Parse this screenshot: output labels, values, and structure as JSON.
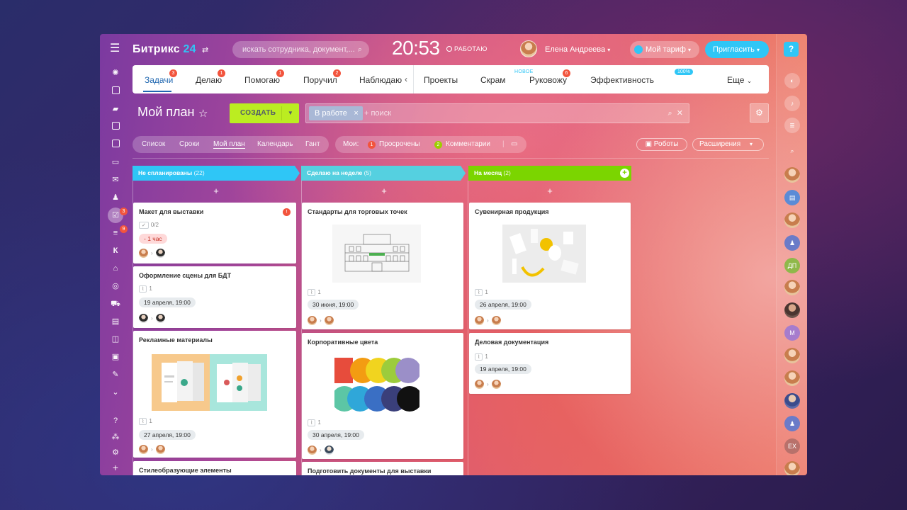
{
  "header": {
    "logo_name": "Битрикс",
    "logo_num": "24",
    "search_placeholder": "искать сотрудника, документ,...",
    "clock": "20:53",
    "work_status": "РАБОТАЮ",
    "user_name": "Елена Андреева",
    "tariff_label": "Мой тариф",
    "invite_label": "Пригласить",
    "help_label": "?"
  },
  "tabs": [
    {
      "label": "Задачи",
      "badge": "3"
    },
    {
      "label": "Делаю",
      "badge": "1"
    },
    {
      "label": "Помогаю",
      "badge": "1"
    },
    {
      "label": "Поручил",
      "badge": "2"
    },
    {
      "label": "Наблюдаю",
      "badge": ""
    },
    {
      "label": "Проекты",
      "badge": ""
    },
    {
      "label": "Скрам",
      "badge": "",
      "tag": "НОВОЕ"
    },
    {
      "label": "Руковожу",
      "badge": "6"
    },
    {
      "label": "Эффективность",
      "badge": "",
      "tag": "100%"
    },
    {
      "label": "Еще",
      "badge": ""
    }
  ],
  "toolbar": {
    "title": "Мой план",
    "create_label": "СОЗДАТЬ",
    "filter_chip": "В работе",
    "filter_placeholder": "+ поиск"
  },
  "views": [
    "Список",
    "Сроки",
    "Мой план",
    "Календарь",
    "Гант"
  ],
  "counters": {
    "prefix": "Мои:",
    "overdue_count": "1",
    "overdue_label": "Просрочены",
    "comments_count": "2",
    "comments_label": "Комментарии"
  },
  "buttons": {
    "robots": "Роботы",
    "extensions": "Расширения"
  },
  "left_sidebar_badges": {
    "tasks": "3",
    "filter": "9",
    "k_label": "К"
  },
  "right_sidebar_initials": [
    "ДП",
    "М",
    "EX"
  ],
  "columns": [
    {
      "name": "Не спланированы",
      "count": "(22)",
      "color": "#2fc6f6",
      "cards": [
        {
          "title": "Макет для выставки",
          "meta": "0/2",
          "deadline": "- 1 час",
          "alert": "!"
        },
        {
          "title": "Оформление сцены для БДТ",
          "meta": "1",
          "date": "19 апреля, 19:00"
        },
        {
          "title": "Рекламные материалы",
          "meta": "1",
          "date": "27 апреля, 19:00"
        },
        {
          "title": "Стилеобразующие элементы"
        }
      ]
    },
    {
      "name": "Сделаю на неделе",
      "count": "(5)",
      "color": "#55d0e0",
      "cards": [
        {
          "title": "Стандарты для торговых точек",
          "meta": "1",
          "date": "30 июня, 19:00"
        },
        {
          "title": "Корпоративные цвета",
          "meta": "1",
          "date": "30 апреля, 19:00"
        },
        {
          "title": "Подготовить документы для выставки"
        }
      ]
    },
    {
      "name": "На месяц",
      "count": "(2)",
      "color": "#7bd500",
      "cards": [
        {
          "title": "Сувенирная продукция",
          "meta": "1",
          "date": "26 апреля, 19:00"
        },
        {
          "title": "Деловая документация",
          "meta": "1",
          "date": "19 апреля, 19:00"
        }
      ]
    }
  ],
  "colors": {
    "accent": "#2fc6f6",
    "create_button": "#bbed21",
    "badge": "#f2543d",
    "active_tab": "#2067b0"
  }
}
